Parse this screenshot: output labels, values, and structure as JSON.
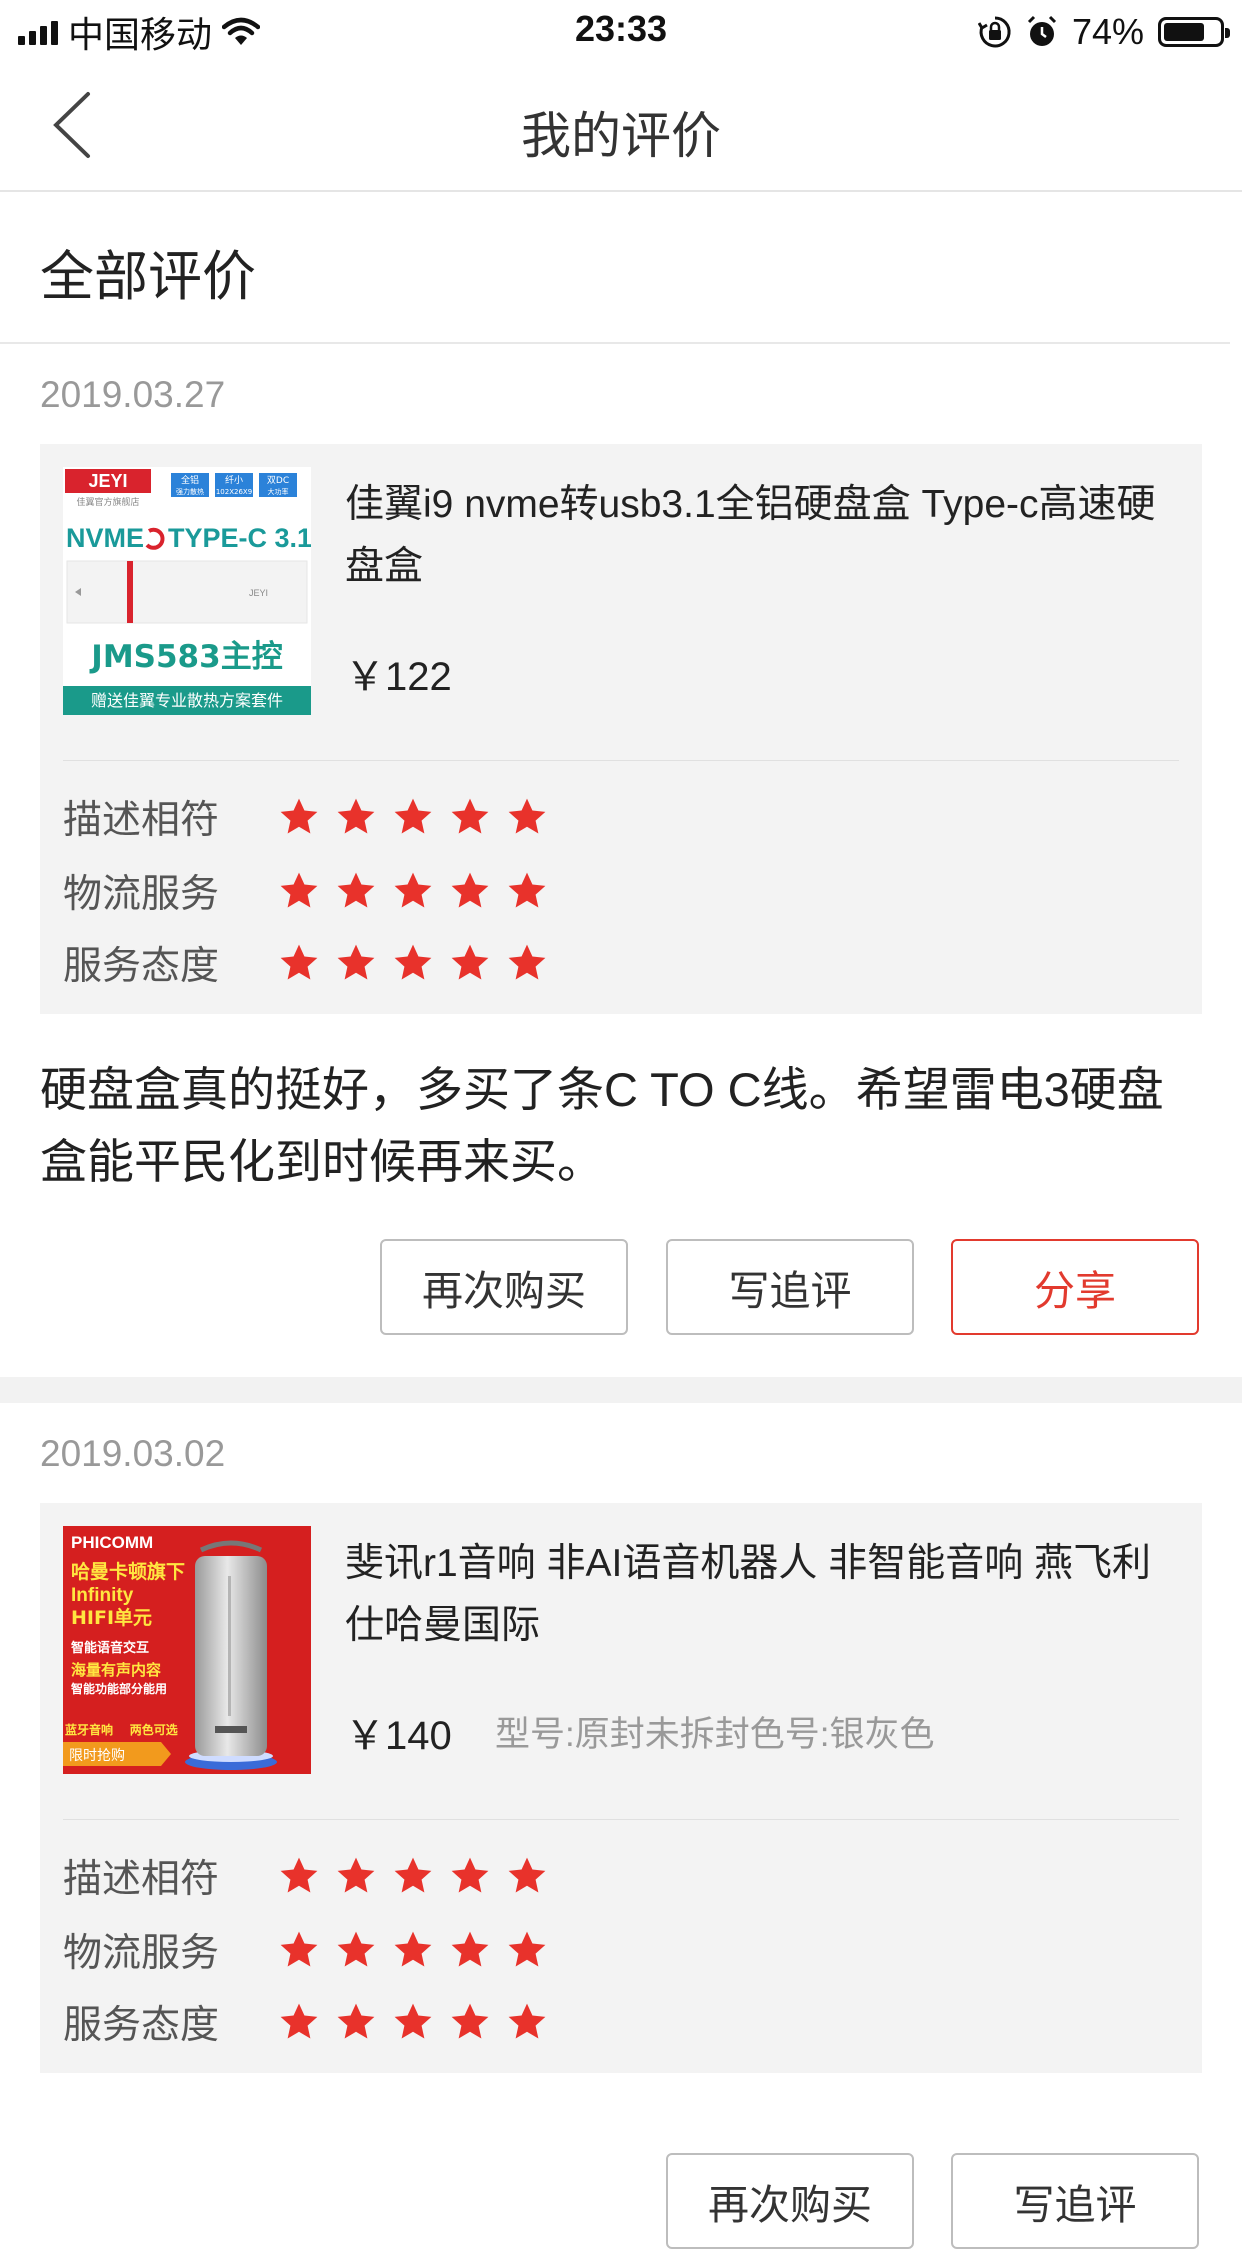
{
  "status_bar": {
    "carrier": "中国移动",
    "time": "23:33",
    "battery": "74%",
    "battery_level": 0.74
  },
  "header": {
    "title": "我的评价"
  },
  "section": {
    "title": "全部评价"
  },
  "rating_labels": [
    "描述相符",
    "物流服务",
    "服务态度"
  ],
  "buttons": {
    "buy_again": "再次购买",
    "follow_up": "写追评",
    "share": "分享"
  },
  "reviews": [
    {
      "date": "2019.03.27",
      "product_title": "佳翼i9 nvme转usb3.1全铝硬盘盒 Type-c高速硬盘盒",
      "price": "￥122",
      "spec": "",
      "thumb": {
        "brand": "JEYI",
        "tagline": "佳翼官方旗舰店",
        "badges": [
          "全铝",
          "纤小",
          "双DC"
        ],
        "badge_subs": [
          "强力散热",
          "102X26X9",
          "大功率"
        ],
        "headline_left": "NVME",
        "headline_right": "TYPE-C 3.1",
        "chip": "JMS583主控",
        "footer": "赠送佳翼专业散热方案套件",
        "device_brand": "JEYI"
      },
      "ratings": [
        5,
        5,
        5
      ],
      "content": "硬盘盒真的挺好，多买了条C TO C线。希望雷电3硬盘盒能平民化到时候再来买。"
    },
    {
      "date": "2019.03.02",
      "product_title": "斐讯r1音响 非AI语音机器人 非智能音响 燕飞利仕哈曼国际",
      "price": "￥140",
      "spec": "型号:原封未拆封色号:银灰色",
      "thumb": {
        "brand": "PHICOMM",
        "lines": [
          "哈曼卡顿旗下",
          "Infinity",
          "HIFI单元"
        ],
        "features": [
          "智能语音交互",
          "海量有声内容",
          "智能功能部分能用"
        ],
        "bottom": "蓝牙音响    两色可选",
        "tag": "限时抢购"
      },
      "ratings": [
        5,
        5,
        5
      ]
    }
  ]
}
